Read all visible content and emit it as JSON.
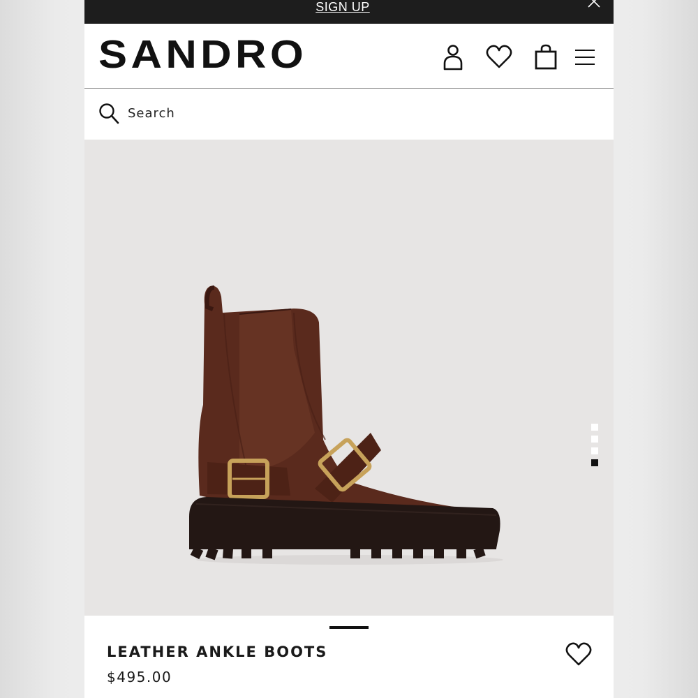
{
  "promo": {
    "signup_label": "SIGN UP"
  },
  "header": {
    "brand": "SANDRO"
  },
  "search": {
    "placeholder": "Search"
  },
  "product": {
    "name": "LEATHER ANKLE BOOTS",
    "price": "$495.00"
  },
  "gallery": {
    "slide_count": 4,
    "active_slide": 4
  },
  "colors": {
    "top_bar": "#1d1d1d",
    "image_background": "#e7e5e4",
    "boot_brown": "#5a2a1d",
    "sole": "#231714",
    "buckle": "#c7a25a"
  },
  "icons": [
    "close-icon",
    "account-icon",
    "wishlist-icon",
    "bag-icon",
    "menu-icon",
    "search-icon",
    "heart-icon"
  ]
}
